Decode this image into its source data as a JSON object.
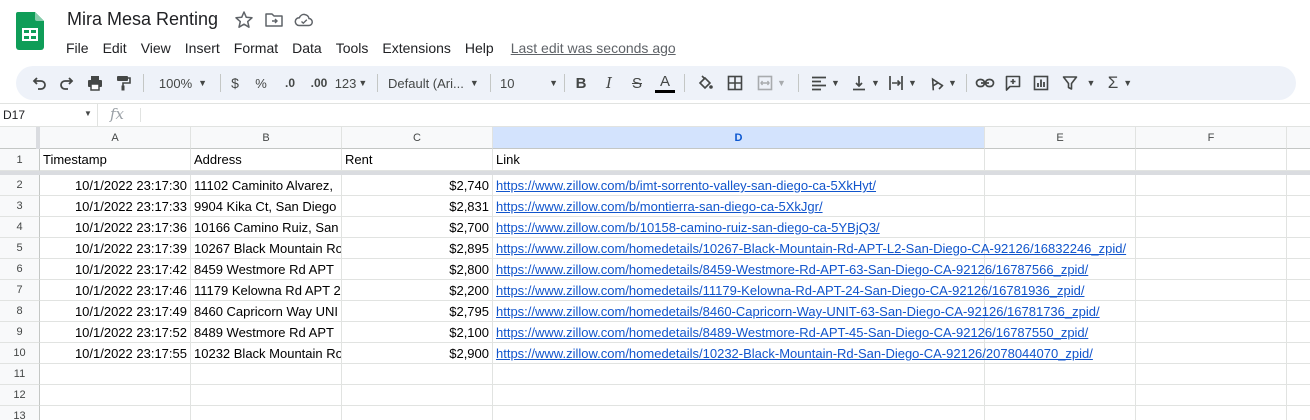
{
  "document": {
    "title": "Mira Mesa Renting",
    "last_edit": "Last edit was seconds ago"
  },
  "menu": [
    "File",
    "Edit",
    "View",
    "Insert",
    "Format",
    "Data",
    "Tools",
    "Extensions",
    "Help"
  ],
  "toolbar": {
    "zoom": "100%",
    "currency": "$",
    "percent": "%",
    "decrease_decimal": ".0",
    "increase_decimal": ".00",
    "number_format": "123",
    "font": "Default (Ari...",
    "font_size": "10"
  },
  "formula_bar": {
    "cell_ref": "D17",
    "fx": "fx"
  },
  "columns": [
    "A",
    "B",
    "C",
    "D",
    "E",
    "F"
  ],
  "headers": {
    "timestamp": "Timestamp",
    "address": "Address",
    "rent": "Rent",
    "link": "Link"
  },
  "rows": [
    {
      "timestamp": "10/1/2022 23:17:30",
      "address": "11102 Caminito Alvarez,",
      "rent": "$2,740",
      "link": "https://www.zillow.com/b/imt-sorrento-valley-san-diego-ca-5XkHyt/"
    },
    {
      "timestamp": "10/1/2022 23:17:33",
      "address": "9904 Kika Ct, San Diego",
      "rent": "$2,831",
      "link": "https://www.zillow.com/b/montierra-san-diego-ca-5XkJgr/"
    },
    {
      "timestamp": "10/1/2022 23:17:36",
      "address": "10166 Camino Ruiz, San",
      "rent": "$2,700",
      "link": "https://www.zillow.com/b/10158-camino-ruiz-san-diego-ca-5YBjQ3/"
    },
    {
      "timestamp": "10/1/2022 23:17:39",
      "address": "10267 Black Mountain Ro",
      "rent": "$2,895",
      "link": "https://www.zillow.com/homedetails/10267-Black-Mountain-Rd-APT-L2-San-Diego-CA-92126/16832246_zpid/"
    },
    {
      "timestamp": "10/1/2022 23:17:42",
      "address": "8459 Westmore Rd APT",
      "rent": "$2,800",
      "link": "https://www.zillow.com/homedetails/8459-Westmore-Rd-APT-63-San-Diego-CA-92126/16787566_zpid/"
    },
    {
      "timestamp": "10/1/2022 23:17:46",
      "address": "11179 Kelowna Rd APT 2",
      "rent": "$2,200",
      "link": "https://www.zillow.com/homedetails/11179-Kelowna-Rd-APT-24-San-Diego-CA-92126/16781936_zpid/"
    },
    {
      "timestamp": "10/1/2022 23:17:49",
      "address": "8460 Capricorn Way UNI",
      "rent": "$2,795",
      "link": "https://www.zillow.com/homedetails/8460-Capricorn-Way-UNIT-63-San-Diego-CA-92126/16781736_zpid/"
    },
    {
      "timestamp": "10/1/2022 23:17:52",
      "address": "8489 Westmore Rd APT",
      "rent": "$2,100",
      "link": "https://www.zillow.com/homedetails/8489-Westmore-Rd-APT-45-San-Diego-CA-92126/16787550_zpid/"
    },
    {
      "timestamp": "10/1/2022 23:17:55",
      "address": "10232 Black Mountain Ro",
      "rent": "$2,900",
      "link": "https://www.zillow.com/homedetails/10232-Black-Mountain-Rd-San-Diego-CA-92126/2078044070_zpid/"
    }
  ],
  "row_numbers": [
    "1",
    "2",
    "3",
    "4",
    "5",
    "6",
    "7",
    "8",
    "9",
    "10",
    "11",
    "12",
    "13"
  ],
  "colors": {
    "sheets_green": "#0f9d58",
    "link": "#1155cc",
    "toolbar_bg": "#eef2f9"
  }
}
